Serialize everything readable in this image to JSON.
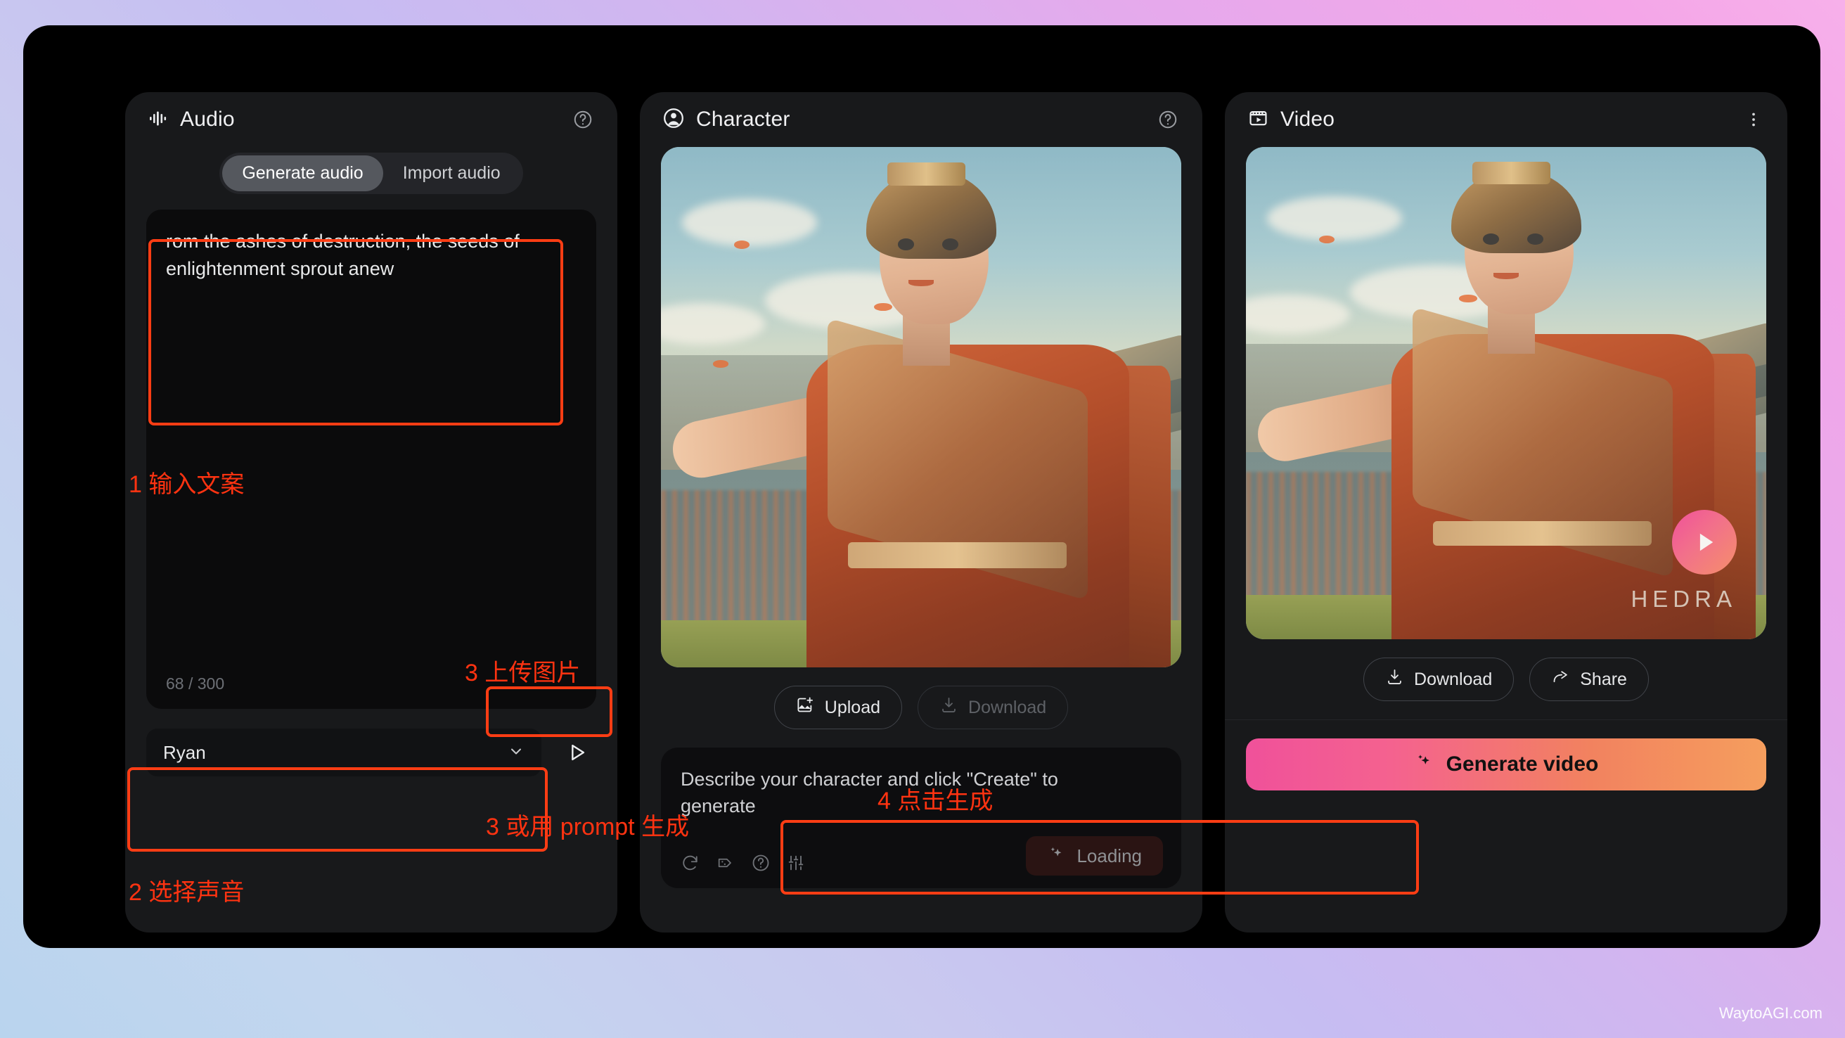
{
  "watermark": "WaytoAGI.com",
  "audio_panel": {
    "title": "Audio",
    "icon": "waveform-icon",
    "help_icon": "help-circle-icon",
    "tabs": [
      {
        "label": "Generate audio",
        "active": true
      },
      {
        "label": "Import audio",
        "active": false
      }
    ],
    "script_text": "rom the ashes of destruction, the seeds of enlightenment sprout anew",
    "char_count": "68 / 300",
    "voice": {
      "selected": "Ryan",
      "chevron_icon": "chevron-down-icon",
      "preview_icon": "play-triangle-icon"
    }
  },
  "character_panel": {
    "title": "Character",
    "icon": "person-circle-icon",
    "help_icon": "help-circle-icon",
    "upload_button": "Upload",
    "upload_icon": "image-plus-icon",
    "download_button": "Download",
    "download_icon": "download-icon",
    "prompt_placeholder": "Describe your character and click \"Create\" to generate",
    "tool_icons": [
      "refresh-icon",
      "dice-tag-icon",
      "help-circle-icon",
      "sliders-icon"
    ],
    "loading_button": "Loading",
    "loading_icon": "sparkle-icon"
  },
  "video_panel": {
    "title": "Video",
    "icon": "film-clapper-icon",
    "menu_icon": "kebab-menu-icon",
    "download_button": "Download",
    "download_icon": "download-icon",
    "share_button": "Share",
    "share_icon": "share-arrow-icon",
    "generate_button": "Generate video",
    "generate_icon": "sparkle-icon",
    "play_overlay_icon": "play-triangle-icon",
    "brand_mark": "HEDRA"
  },
  "annotations": [
    {
      "id": "step-1",
      "text": "1 输入文案"
    },
    {
      "id": "step-2",
      "text": "2 选择声音"
    },
    {
      "id": "step-3a",
      "text": "3 上传图片"
    },
    {
      "id": "step-3b",
      "text": "3 或用 prompt 生成"
    },
    {
      "id": "step-4",
      "text": "4 点击生成"
    }
  ],
  "colors": {
    "annotation": "#ff3311",
    "accent_gradient_start": "#f0519a",
    "accent_gradient_end": "#f59e5e",
    "panel_bg": "#18191b",
    "window_bg": "#000000"
  }
}
